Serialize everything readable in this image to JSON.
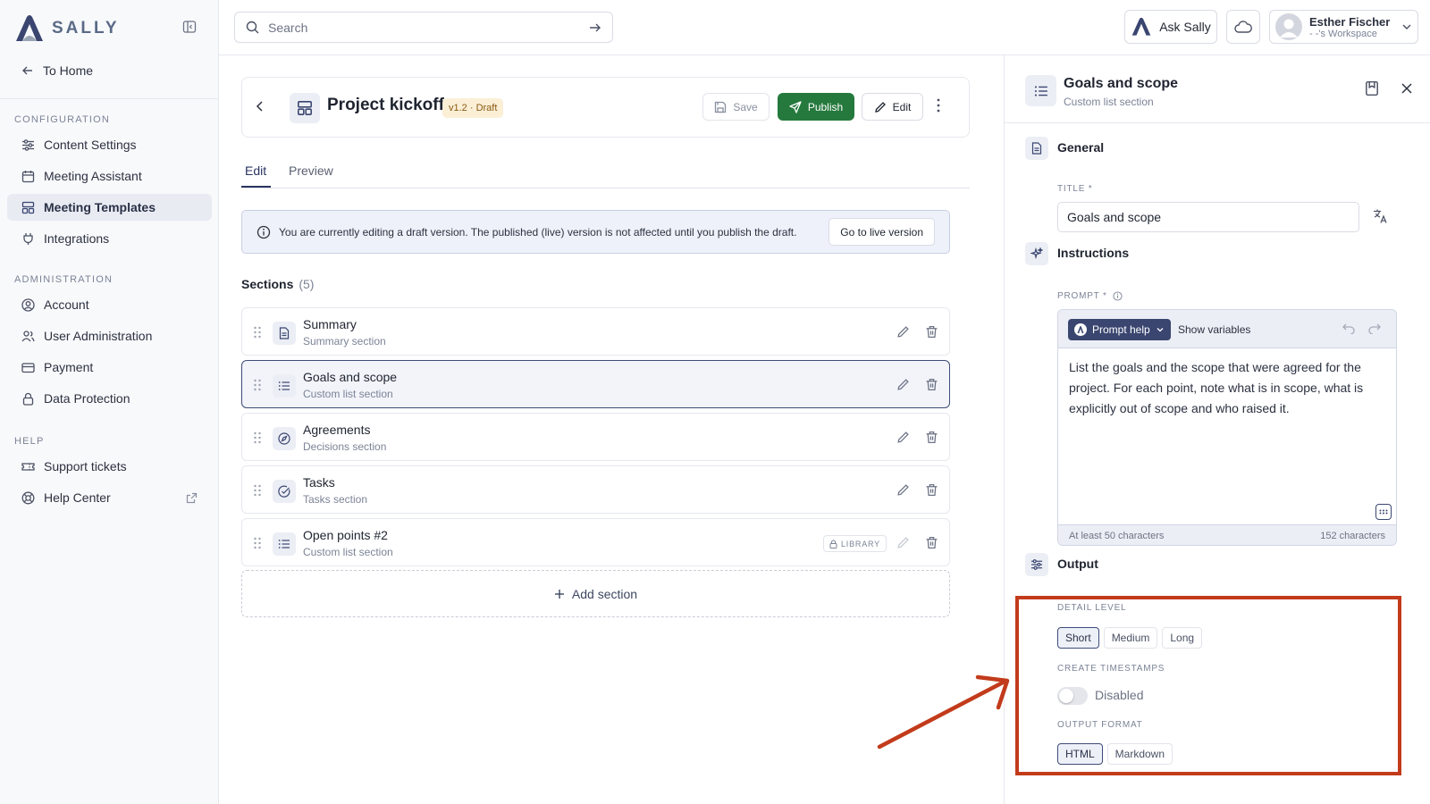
{
  "app": {
    "brand": "SALLY",
    "accent": "#3a4670",
    "publish_color": "#25793d",
    "annotation_color": "#c23b1b"
  },
  "sidebar": {
    "home_label": "To Home",
    "sections": [
      {
        "label": "CONFIGURATION",
        "items": [
          {
            "label": "Content Settings",
            "icon": "sliders-icon"
          },
          {
            "label": "Meeting Assistant",
            "icon": "calendar-icon"
          },
          {
            "label": "Meeting Templates",
            "icon": "template-icon",
            "active": true
          },
          {
            "label": "Integrations",
            "icon": "plug-icon"
          }
        ]
      },
      {
        "label": "ADMINISTRATION",
        "items": [
          {
            "label": "Account",
            "icon": "account-icon"
          },
          {
            "label": "User Administration",
            "icon": "users-icon"
          },
          {
            "label": "Payment",
            "icon": "card-icon"
          },
          {
            "label": "Data Protection",
            "icon": "lock-icon"
          }
        ]
      },
      {
        "label": "HELP",
        "items": [
          {
            "label": "Support tickets",
            "icon": "ticket-icon"
          },
          {
            "label": "Help Center",
            "icon": "lifebuoy-icon"
          }
        ]
      }
    ]
  },
  "topbar": {
    "search_placeholder": "Search",
    "ask_label": "Ask Sally",
    "user_name": "Esther Fischer",
    "workspace": "- -'s Workspace"
  },
  "template": {
    "title": "Project kickoff",
    "version": "v1.2 · Draft",
    "save_label": "Save",
    "publish_label": "Publish",
    "edit_label": "Edit"
  },
  "tabs": {
    "edit": "Edit",
    "preview": "Preview"
  },
  "notice": {
    "text": "You are currently editing a draft version. The published (live) version is not affected until you publish the draft.",
    "button": "Go to live version"
  },
  "sections": {
    "heading": "Sections",
    "count": "(5)",
    "items": [
      {
        "title": "Summary",
        "subtitle": "Summary section",
        "icon": "document-icon"
      },
      {
        "title": "Goals and scope",
        "subtitle": "Custom list section",
        "icon": "list-icon",
        "selected": true
      },
      {
        "title": "Agreements",
        "subtitle": "Decisions section",
        "icon": "compass-icon"
      },
      {
        "title": "Tasks",
        "subtitle": "Tasks section",
        "icon": "check-circle-icon"
      },
      {
        "title": "Open points #2",
        "subtitle": "Custom list section",
        "icon": "list-icon",
        "library": "LIBRARY"
      }
    ],
    "add_label": "Add section"
  },
  "panel": {
    "title": "Goals and scope",
    "subtitle": "Custom list section",
    "general": {
      "heading": "General",
      "title_label": "TITLE *",
      "title_value": "Goals and scope"
    },
    "instructions": {
      "heading": "Instructions",
      "prompt_label": "PROMPT *",
      "prompt_help": "Prompt help",
      "show_variables": "Show variables",
      "prompt_text": "List the goals and the scope that were agreed for the project. For each point, note what is in scope, what is explicitly out of scope and who raised it.",
      "min_hint": "At least 50 characters",
      "char_count": "152 characters"
    },
    "output": {
      "heading": "Output",
      "detail_label": "DETAIL LEVEL",
      "detail_options": [
        "Short",
        "Medium",
        "Long"
      ],
      "detail_selected": "Short",
      "timestamps_label": "CREATE TIMESTAMPS",
      "timestamps_value": "Disabled",
      "timestamps_enabled": false,
      "format_label": "OUTPUT FORMAT",
      "format_options": [
        "HTML",
        "Markdown"
      ],
      "format_selected": "HTML"
    }
  }
}
